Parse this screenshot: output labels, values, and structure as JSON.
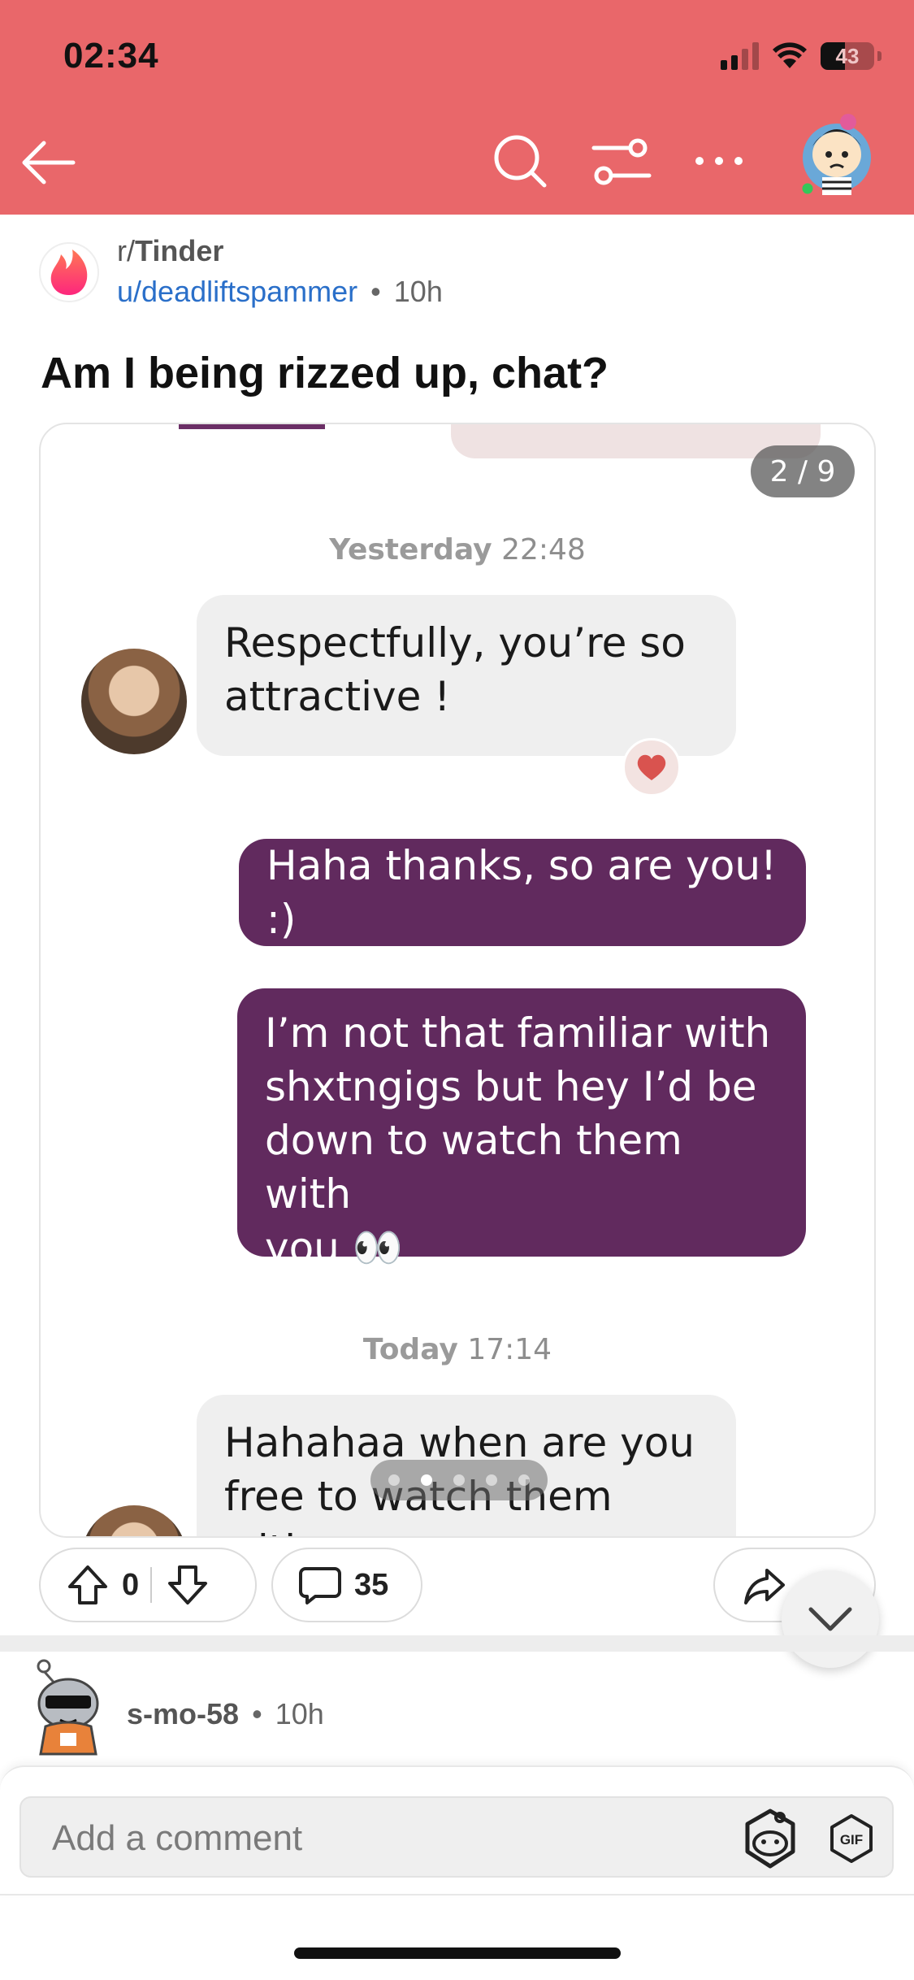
{
  "status_bar": {
    "time": "02:34",
    "battery": "43"
  },
  "header": {
    "icons": [
      "back-arrow-icon",
      "search-icon",
      "filter-icon",
      "more-icon",
      "user-avatar"
    ],
    "background": "#e9676a"
  },
  "post": {
    "subreddit_prefix": "r/",
    "subreddit": "Tinder",
    "author": "u/deadliftspammer",
    "separator": "•",
    "age": "10h",
    "title": "Am I being rizzed up, chat?"
  },
  "image": {
    "counter": "2 / 9",
    "timestamp1_day": "Yesterday",
    "timestamp1_time": "22:48",
    "msg_in_1_line1": "Respectfully, you’re so",
    "msg_in_1_line2": "attractive !",
    "msg_out_1": "Haha thanks, so are you! :)",
    "msg_out_2_line1": "I’m not that familiar with",
    "msg_out_2_line2": "shxtngigs but hey I’d be",
    "msg_out_2_line3": "down to watch them with",
    "msg_out_2_line4": "you 👀",
    "timestamp2_day": "Today",
    "timestamp2_time": "17:14",
    "msg_in_2_line1": "Hahahaa when are you",
    "msg_in_2_line2": "free to watch them with",
    "bubble_out_color": "#612a5e",
    "bubble_in_color": "#efefef"
  },
  "actions": {
    "votes": "0",
    "comments": "35"
  },
  "comment": {
    "author": "s-mo-58",
    "separator": "•",
    "age": "10h"
  },
  "composer": {
    "placeholder": "Add a comment",
    "gif_label": "GIF"
  }
}
